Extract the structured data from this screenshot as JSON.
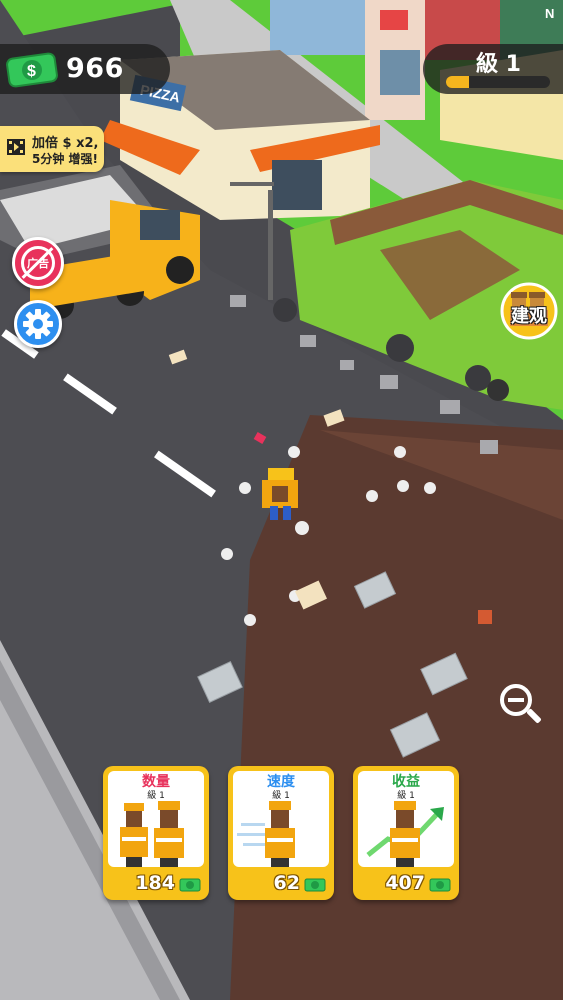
{
  "hud": {
    "money": "966",
    "money_icon": "cash-icon",
    "level_label": "級 1",
    "level_progress": 0.22
  },
  "boost": {
    "line1": "加倍 $ x2,",
    "line2": "5分钟 增强!",
    "icon": "video-icon"
  },
  "side_buttons": {
    "no_ads_label": "广告",
    "settings_icon": "gear-icon"
  },
  "build": {
    "label": "建观"
  },
  "zoom": {
    "icon": "zoom-out-icon"
  },
  "scene_text": {
    "shop_sign": "PIZZA",
    "corner_sign": "N"
  },
  "upgrades": [
    {
      "title": "数量",
      "level": "級 1",
      "cost": "184",
      "title_color": "#e8325c"
    },
    {
      "title": "速度",
      "level": "級 1",
      "cost": "62",
      "title_color": "#2d8ff0"
    },
    {
      "title": "收益",
      "level": "級 1",
      "cost": "407",
      "title_color": "#2aa84a"
    }
  ],
  "colors": {
    "card_gold": "#f7c21a",
    "level_bar": "#f5b51e",
    "grass": "#5ecb3a",
    "road": "#4a4a4f",
    "dirt": "#5b3a30"
  }
}
